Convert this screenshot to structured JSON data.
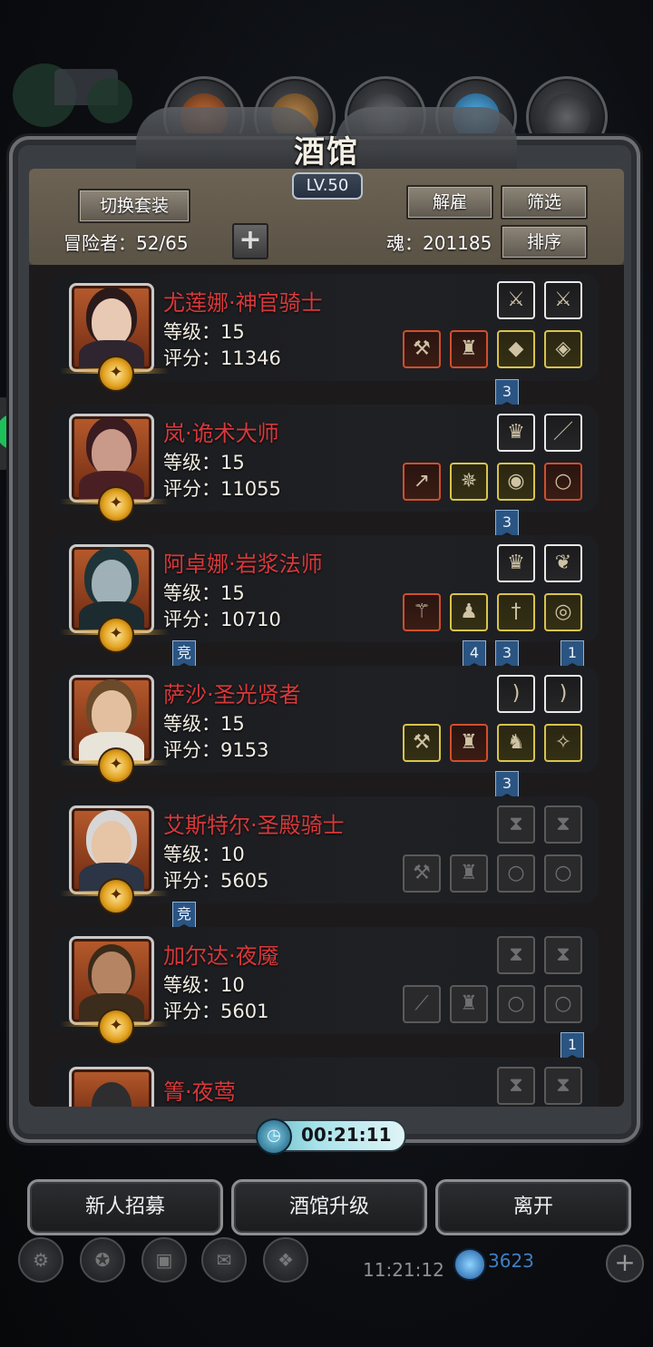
{
  "title": "酒馆",
  "level": "LV.50",
  "buttons": {
    "switch_set": "切换套装",
    "dismiss": "解雇",
    "filter": "筛选",
    "sort": "排序",
    "recruit": "新人招募",
    "upgrade": "酒馆升级",
    "leave": "离开"
  },
  "adventurers_label": "冒险者：52/65",
  "soul_label": "魂：201185",
  "heroes": [
    {
      "name": "尤莲娜·神官骑士",
      "level": "等级：15",
      "score": "评分：11346"
    },
    {
      "name": "岚·诡术大师",
      "level": "等级：15",
      "score": "评分：11055"
    },
    {
      "name": "阿卓娜·岩浆法师",
      "level": "等级：15",
      "score": "评分：10710"
    },
    {
      "name": "萨沙·圣光贤者",
      "level": "等级：15",
      "score": "评分：9153"
    },
    {
      "name": "艾斯特尔·圣殿骑士",
      "level": "等级：10",
      "score": "评分：5605"
    },
    {
      "name": "加尔达·夜魇",
      "level": "等级：10",
      "score": "评分：5601"
    },
    {
      "name": "箐·夜莺"
    }
  ],
  "tags": {
    "t1": "3",
    "t2": "3",
    "t3a": "竞",
    "t3b": "4",
    "t3c": "3",
    "t3d": "1",
    "t4": "3",
    "t5": "竞",
    "t6": "1"
  },
  "timer": "00:21:11",
  "clock": "11:21:12",
  "soul_count": "3623"
}
